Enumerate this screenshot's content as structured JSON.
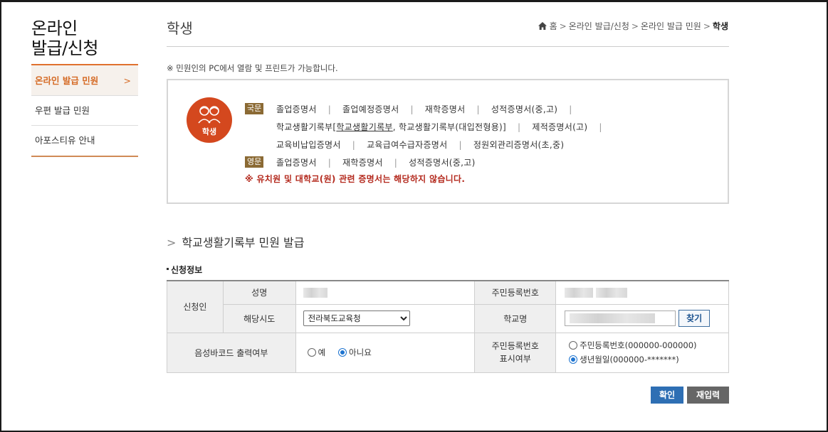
{
  "sidebar": {
    "title_line1": "온라인",
    "title_line2": "발급/신청",
    "items": [
      {
        "label": "온라인 발급 민원",
        "active": true
      },
      {
        "label": "우편 발급 민원"
      },
      {
        "label": "아포스티유 안내"
      }
    ],
    "active_chevron": ">"
  },
  "header": {
    "title": "학생",
    "breadcrumb": [
      "홈",
      "온라인 발급/신청",
      "온라인 발급 민원",
      "학생"
    ]
  },
  "notice": "※ 민원인의 PC에서 열람 및 프린트가 가능합니다.",
  "infobox": {
    "badge_label": "학생",
    "korean_tag": "국문",
    "english_tag": "영문",
    "korean_row1": [
      "졸업증명서",
      "졸업예정증명서",
      "재학증명서",
      "성적증명서(중,고)"
    ],
    "korean_row2_a": "학교생활기록부[",
    "korean_row2_link": "학교생활기록부",
    "korean_row2_b": ", 학교생활기록부(대입전형용)]",
    "korean_row2_c": "제적증명서(고)",
    "korean_row3": [
      "교육비납입증명서",
      "교육급여수급자증명서",
      "정원외관리증명서(초,중)"
    ],
    "english_row": [
      "졸업증명서",
      "재학증명서",
      "성적증명서(중,고)"
    ],
    "warning": "※ 유치원 및 대학교(원) 관련 증명서는 해당하지 않습니다."
  },
  "section": {
    "heading": "학교생활기록부 민원 발급",
    "sub_heading": "신청정보"
  },
  "form": {
    "applicant_label": "신청인",
    "name_label": "성명",
    "rrn_label": "주민등록번호",
    "region_label": "해당시도",
    "region_value": "전라북도교육청",
    "school_label": "학교명",
    "find_button": "찾기",
    "voice_barcode_label": "음성바코드 출력여부",
    "voice_options": [
      {
        "label": "예",
        "selected": false
      },
      {
        "label": "아니요",
        "selected": true
      }
    ],
    "rrn_display_label_1": "주민등록번호",
    "rrn_display_label_2": "표시여부",
    "rrn_display_options": [
      {
        "label": "주민등록번호(000000-000000)",
        "selected": false
      },
      {
        "label": "생년월일(000000-*******)",
        "selected": true
      }
    ]
  },
  "buttons": {
    "confirm": "확인",
    "reset": "재입력"
  },
  "colors": {
    "accent": "#d56a24",
    "badge": "#d4481e",
    "warning": "#b42a1e",
    "primary_button": "#2e6fb4"
  }
}
